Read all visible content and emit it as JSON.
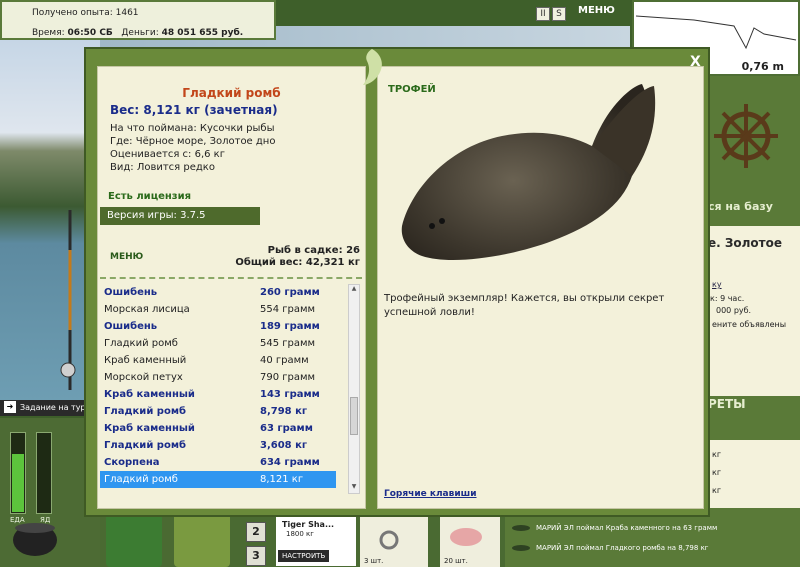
{
  "top_info": {
    "exp_label": "Получено опыта:",
    "exp_value": "1461",
    "time_label": "Время:",
    "time_value": "06:50 СБ",
    "money_label": "Деньги:",
    "money_value": "48 051 655 руб."
  },
  "top_menu": {
    "btn1": "II",
    "btn2": "S",
    "menu_label": "МЕНЮ"
  },
  "depth": {
    "value": "0,76 m"
  },
  "task_bar": {
    "label": "Задание на тур"
  },
  "gauges": {
    "food_label": "ЕДА",
    "poison_label": "ЯД",
    "food_level": 0.75,
    "poison_level": 0.0
  },
  "dialog": {
    "fish_name": "Гладкий ромб",
    "weight": "Вес: 8,121 кг (зачетная)",
    "caught_on": "На что поймана: Кусочки рыбы",
    "where": "Где: Чёрное море, Золотое дно",
    "valued": "Оценивается с: 6,6 кг",
    "kind": "Вид: Ловится редко",
    "license": "Есть лицензия",
    "version": "Версия игры: 3.7.5",
    "menu_label": "МЕНЮ",
    "net_count": "Рыб в садке: 26",
    "total_weight": "Общий вес: 42,321 кг",
    "catch_list": [
      {
        "name": "Ошибень",
        "weight": "260 грамм",
        "highlight": true
      },
      {
        "name": "Морская лисица",
        "weight": "554 грамм",
        "highlight": false
      },
      {
        "name": "Ошибень",
        "weight": "189 грамм",
        "highlight": true
      },
      {
        "name": "Гладкий ромб",
        "weight": "545 грамм",
        "highlight": false
      },
      {
        "name": "Краб каменный",
        "weight": "40 грамм",
        "highlight": false
      },
      {
        "name": "Морской петух",
        "weight": "790 грамм",
        "highlight": false
      },
      {
        "name": "Краб каменный",
        "weight": "143 грамм",
        "highlight": true
      },
      {
        "name": "Гладкий ромб",
        "weight": "8,798 кг",
        "highlight": true
      },
      {
        "name": "Краб каменный",
        "weight": "63 грамм",
        "highlight": true
      },
      {
        "name": "Гладкий ромб",
        "weight": "3,608 кг",
        "highlight": true
      },
      {
        "name": "Скорпена",
        "weight": "634 грамм",
        "highlight": true
      },
      {
        "name": "Гладкий ромб",
        "weight": "8,121 кг",
        "highlight": false,
        "selected": true
      }
    ],
    "trophy_label": "ТРОФЕЙ",
    "trophy_text": "Трофейный экземпляр! Кажется, вы открыли секрет успешной ловли!",
    "hotkeys": "Горячие клавиши",
    "close": "X"
  },
  "right_panel": {
    "to_base": "ся на базу",
    "title": "е. Золотое",
    "link": "ку",
    "line1": "к: 9 час.",
    "line2": "000 руб.",
    "line3": "ените объявлены",
    "secrets": "РЕТЫ",
    "low1": "кг",
    "low2": "кг",
    "low3": "кг"
  },
  "inventory": {
    "slot2": "2",
    "slot3": "3",
    "tiger_name": "Tiger Sha...",
    "tiger_weight": "1800 кг",
    "setup_btn": "НАСТРОИТЬ",
    "count1": "3 шт.",
    "count2": "20 шт."
  },
  "feed": [
    "МАРИЙ ЭЛ поймал Краба каменного на 63 грамм",
    "МАРИЙ ЭЛ поймал Гладкого ромба на 8,798 кг"
  ],
  "colors": {
    "accent": "#6a8a3a",
    "panel": "#f3f1da",
    "highlight": "#1a2c8a",
    "title": "#c2461a",
    "selected": "#2f96f0"
  }
}
